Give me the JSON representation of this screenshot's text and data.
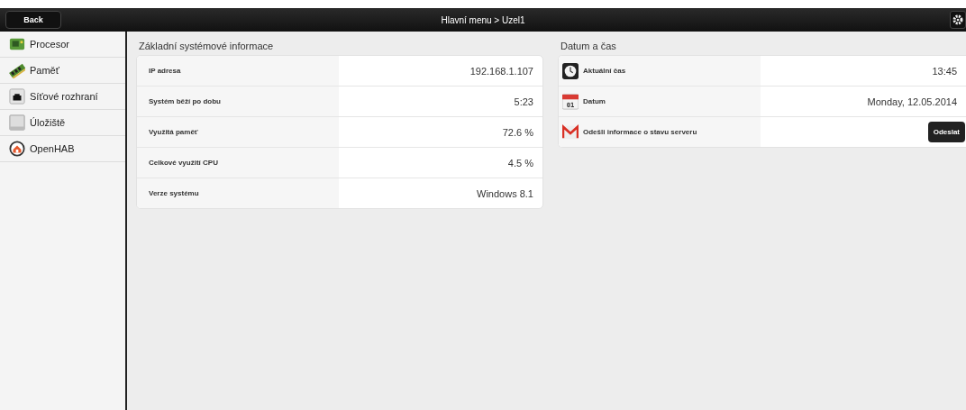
{
  "header": {
    "back": "Back",
    "title": "Hlavní menu > Uzel1"
  },
  "sidebar": {
    "items": [
      {
        "label": "Procesor"
      },
      {
        "label": "Paměť"
      },
      {
        "label": "Síťové rozhraní"
      },
      {
        "label": "Úložiště"
      },
      {
        "label": "OpenHAB"
      }
    ]
  },
  "system_info": {
    "title": "Základní systémové informace",
    "rows": [
      {
        "label": "IP adresa",
        "value": "192.168.1.107"
      },
      {
        "label": "Systém běží po dobu",
        "value": "5:23"
      },
      {
        "label": "Využitá paměť",
        "value": "72.6 %"
      },
      {
        "label": "Celkové využití CPU",
        "value": "4.5 %"
      },
      {
        "label": "Verze systému",
        "value": "Windows 8.1"
      }
    ]
  },
  "date_time": {
    "title": "Datum a čas",
    "rows": [
      {
        "kind": "value",
        "label": "Aktuální čas",
        "value": "13:45"
      },
      {
        "kind": "value",
        "icon_text": "01",
        "label": "Datum",
        "value": "Monday, 12.05.2014"
      },
      {
        "kind": "button",
        "label": "Odešli informace o stavu serveru",
        "button": "Odeslat"
      }
    ]
  }
}
